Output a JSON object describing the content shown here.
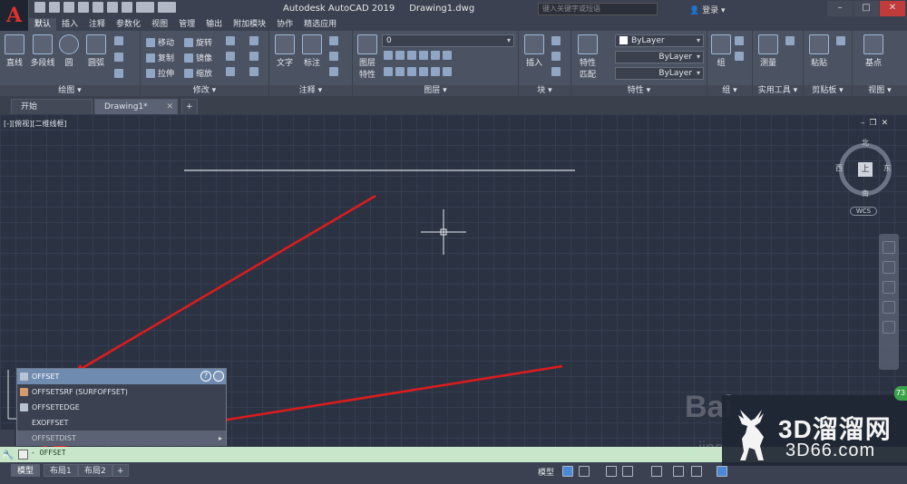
{
  "title_bar": {
    "app_title": "Autodesk AutoCAD 2019",
    "document": "Drawing1.dwg",
    "search_placeholder": "键入关键字或短语",
    "login_label": "登录"
  },
  "menu_tabs": [
    "默认",
    "插入",
    "注释",
    "参数化",
    "视图",
    "管理",
    "输出",
    "附加模块",
    "协作",
    "精选应用"
  ],
  "ribbon": {
    "draw": {
      "label": "绘图",
      "line": "直线",
      "polyline": "多段线",
      "circle": "圆",
      "arc": "圆弧"
    },
    "modify": {
      "label": "修改",
      "move": "移动",
      "rotate": "旋转",
      "copy": "复制",
      "mirror": "镜像",
      "stretch": "拉伸",
      "scale": "缩放"
    },
    "annotation": {
      "label": "注释",
      "text": "文字",
      "dimension": "标注"
    },
    "layers": {
      "label": "图层",
      "layer_props": "图层\n特性",
      "layer_value": "0"
    },
    "block": {
      "label": "块",
      "insert": "插入"
    },
    "properties": {
      "label": "特性",
      "match": "特性\n匹配",
      "color": "ByLayer",
      "linetype": "ByLayer",
      "lineweight": "ByLayer"
    },
    "groups": {
      "label": "组",
      "group": "组"
    },
    "utilities": {
      "label": "实用工具",
      "measure": "测量"
    },
    "clipboard": {
      "label": "剪贴板",
      "paste": "粘贴"
    },
    "view": {
      "label": "视图",
      "base": "基点"
    }
  },
  "doc_tabs": {
    "start": "开始",
    "drawing": "Drawing1*"
  },
  "viewport_label": "[-][俯视][二维线框]",
  "viewcube": {
    "north": "北",
    "south": "南",
    "east": "东",
    "west": "西",
    "face": "上",
    "wcs": "WCS"
  },
  "autocomplete": {
    "items": [
      {
        "label": "OFFSET",
        "selected": true
      },
      {
        "label": "OFFSETSRF (SURFOFFSET)",
        "selected": false
      },
      {
        "label": "OFFSETEDGE",
        "selected": false
      },
      {
        "label": "EXOFFSET",
        "selected": false
      },
      {
        "label": "OFFSETDIST",
        "selected": false
      }
    ],
    "help": "?"
  },
  "command_line": {
    "text": "- OFFSET"
  },
  "status_bar": {
    "tabs": [
      "模型",
      "布局1",
      "布局2"
    ],
    "model_label": "模型"
  },
  "watermark": {
    "title": "3D溜溜网",
    "url": "3D66.com",
    "baidu": "Bai",
    "baidu_sub": "jing"
  },
  "badge": "73",
  "colors": {
    "accent": "#6f8bb0",
    "arrow": "#e01b1b",
    "cmd_bg": "#c8e6c9"
  }
}
